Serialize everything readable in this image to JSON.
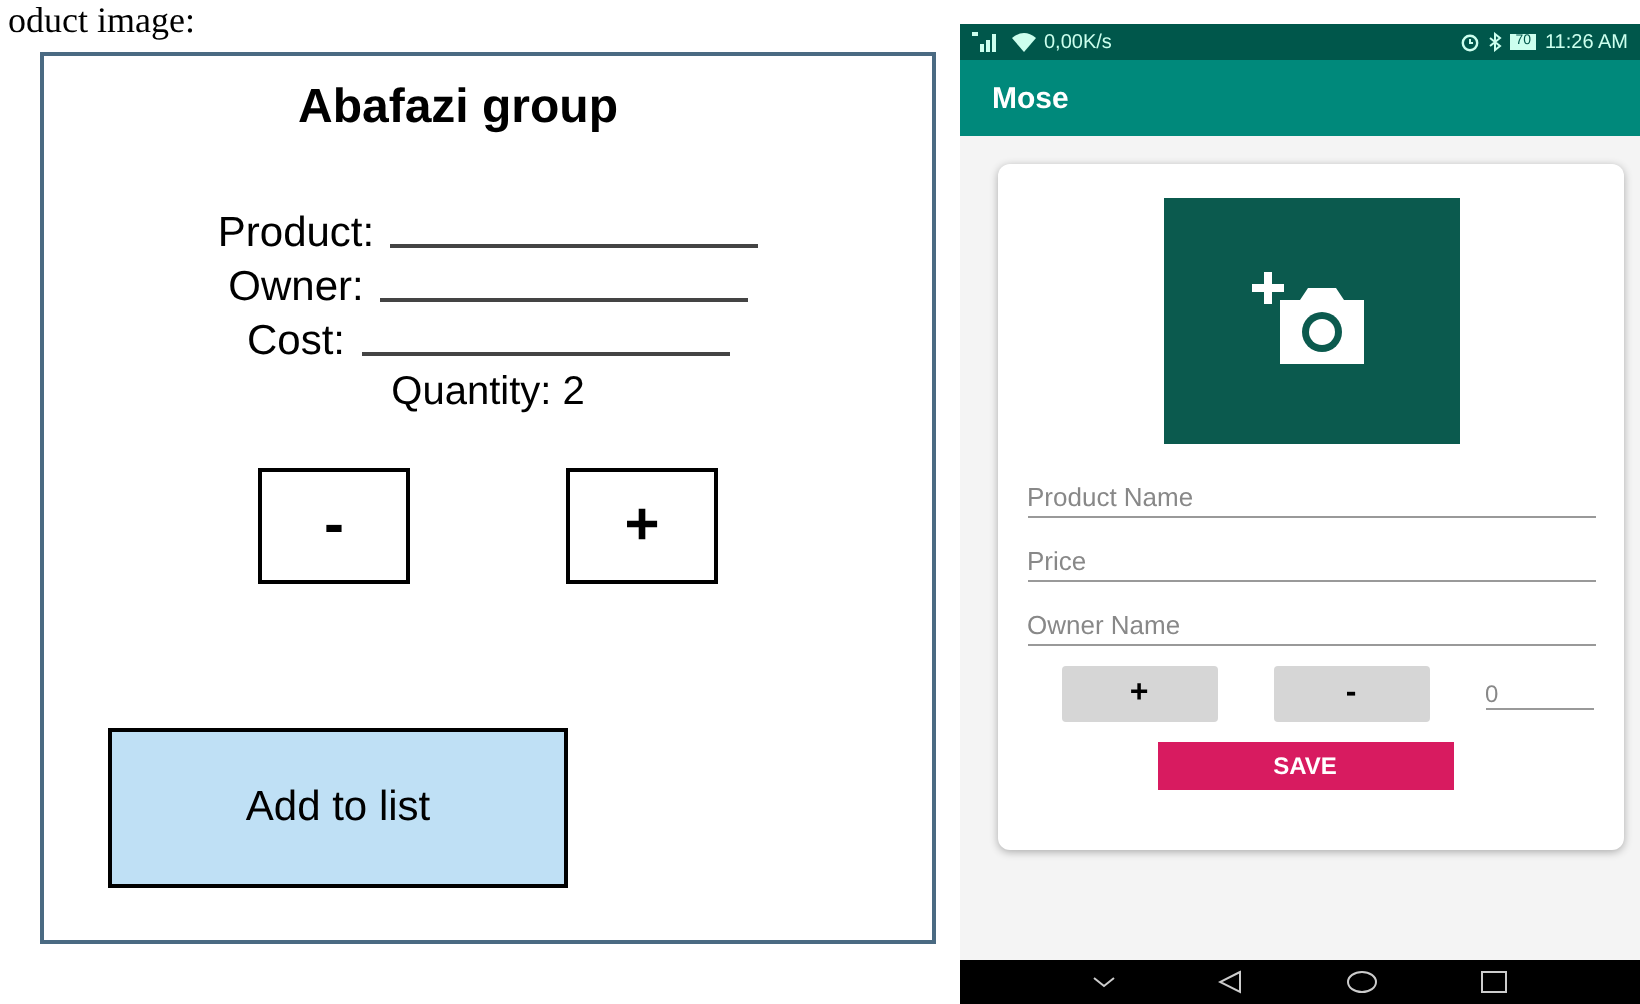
{
  "caption": "oduct image:",
  "mockup": {
    "title": "Abafazi group",
    "fields": [
      {
        "label": "Product:"
      },
      {
        "label": "Owner:"
      },
      {
        "label": "Cost:"
      }
    ],
    "quantity": "Quantity: 2",
    "buttons": [
      "-",
      "+"
    ],
    "add_button": "Add to list"
  },
  "phone": {
    "status_bar": {
      "network": "0,00K/s",
      "battery": "70",
      "time": "11:26 AM"
    },
    "app_title": "Mose",
    "fields": [
      {
        "placeholder": "Product Name"
      },
      {
        "placeholder": "Price"
      },
      {
        "placeholder": "Owner Name"
      }
    ],
    "buttons": [
      "+",
      "-"
    ],
    "quantity_field": {
      "placeholder": "0"
    },
    "save_button": "SAVE"
  }
}
